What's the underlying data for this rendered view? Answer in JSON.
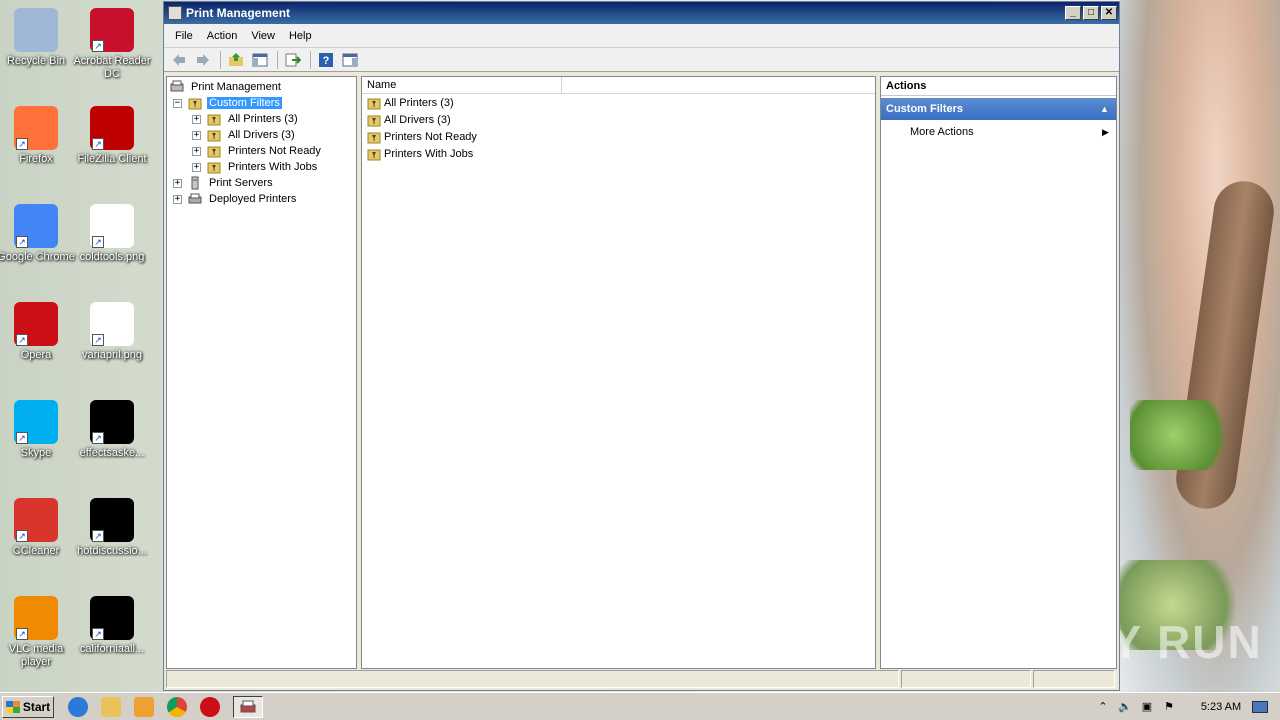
{
  "desktop": {
    "icons": [
      {
        "label": "Recycle Bin",
        "color": "#9fb8d8"
      },
      {
        "label": "Acrobat Reader DC",
        "color": "#c8102e"
      },
      {
        "label": "Firefox",
        "color": "#ff7139"
      },
      {
        "label": "FileZilla Client",
        "color": "#bf0000"
      },
      {
        "label": "Google Chrome",
        "color": "#4285f4"
      },
      {
        "label": "coldtools.png",
        "color": "#ffffff"
      },
      {
        "label": "Opera",
        "color": "#cc0f16"
      },
      {
        "label": "variapril.png",
        "color": "#ffffff"
      },
      {
        "label": "Skype",
        "color": "#00aff0"
      },
      {
        "label": "effectsaske...",
        "color": "#000000"
      },
      {
        "label": "CCleaner",
        "color": "#d9352c"
      },
      {
        "label": "hotdiscussio...",
        "color": "#000000"
      },
      {
        "label": "VLC media player",
        "color": "#f08a00"
      },
      {
        "label": "californiaall...",
        "color": "#000000"
      }
    ],
    "watermark": "ANY RUN"
  },
  "window": {
    "title": "Print Management",
    "menu": [
      "File",
      "Action",
      "View",
      "Help"
    ],
    "tree": {
      "root": "Print Management",
      "custom_filters": "Custom Filters",
      "children": [
        "All Printers (3)",
        "All Drivers (3)",
        "Printers Not Ready",
        "Printers With Jobs"
      ],
      "print_servers": "Print Servers",
      "deployed_printers": "Deployed Printers"
    },
    "list": {
      "column_name": "Name",
      "items": [
        "All Printers (3)",
        "All Drivers (3)",
        "Printers Not Ready",
        "Printers With Jobs"
      ]
    },
    "actions": {
      "header": "Actions",
      "section": "Custom Filters",
      "more_actions": "More Actions"
    }
  },
  "taskbar": {
    "start": "Start",
    "clock": "5:23 AM"
  }
}
